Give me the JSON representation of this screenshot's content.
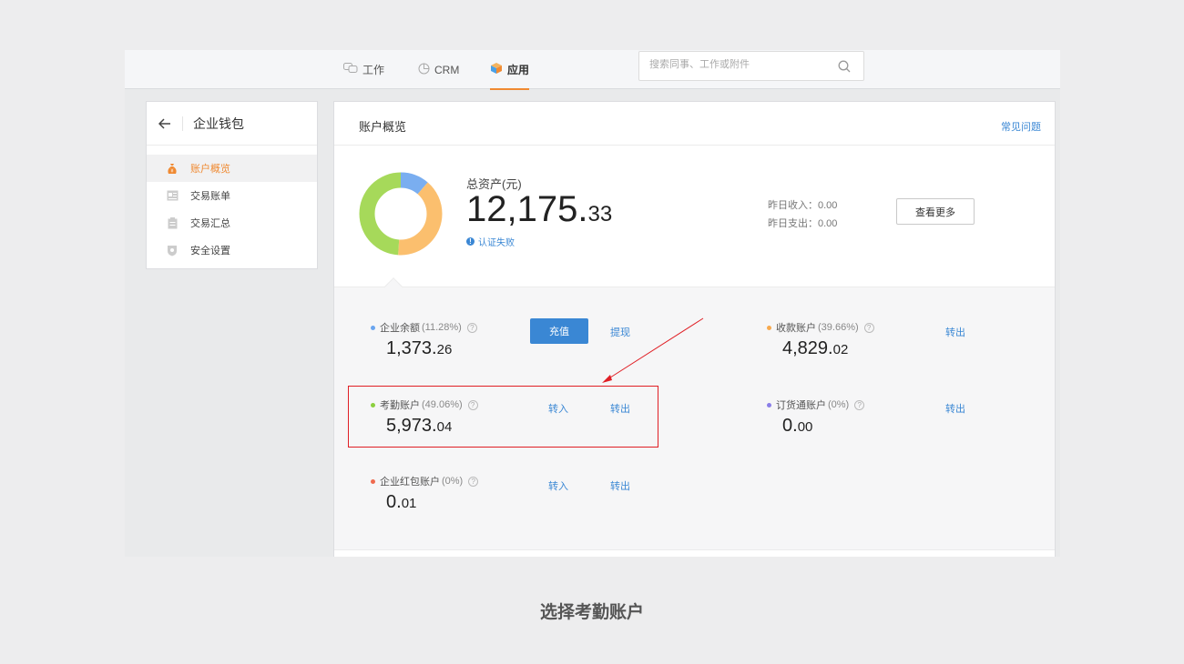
{
  "topnav": {
    "tabs": [
      {
        "label": "工作",
        "icon": "chat-bubbles-icon",
        "active": false
      },
      {
        "label": "CRM",
        "icon": "pie-icon",
        "active": false
      },
      {
        "label": "应用",
        "icon": "cube-icon",
        "active": true
      }
    ],
    "search_placeholder": "搜索同事、工作或附件"
  },
  "sidebar": {
    "title": "企业钱包",
    "items": [
      {
        "label": "账户概览",
        "icon": "money-bag-icon",
        "active": true
      },
      {
        "label": "交易账单",
        "icon": "bill-icon",
        "active": false
      },
      {
        "label": "交易汇总",
        "icon": "summary-icon",
        "active": false
      },
      {
        "label": "安全设置",
        "icon": "shield-icon",
        "active": false
      }
    ]
  },
  "main": {
    "title": "账户概览",
    "faq": "常见问题",
    "total_label": "总资产(元)",
    "total_int": "12,175.",
    "total_dec": "33",
    "auth_status": "认证失败",
    "yesterday_income": "昨日收入：0.00",
    "yesterday_expense": "昨日支出：0.00",
    "more_button": "查看更多",
    "donut": [
      {
        "name": "企业余额",
        "percent": 11.28,
        "color": "#7aaef0"
      },
      {
        "name": "收款账户",
        "percent": 39.66,
        "color": "#fbbf6e"
      },
      {
        "name": "考勤账户",
        "percent": 49.06,
        "color": "#a6d95a"
      }
    ]
  },
  "accounts": {
    "balance": {
      "name": "企业余额",
      "pct": "(11.28%)",
      "int": "1,373.",
      "dec": "26",
      "color": "#6aa5ef",
      "charge": "充值",
      "withdraw": "提现"
    },
    "receive": {
      "name": "收款账户",
      "pct": "(39.66%)",
      "int": "4,829.",
      "dec": "02",
      "color": "#f7a94e",
      "out": "转出"
    },
    "attendance": {
      "name": "考勤账户",
      "pct": "(49.06%)",
      "int": "5,973.",
      "dec": "04",
      "color": "#8ccf3e",
      "in": "转入",
      "out": "转出"
    },
    "order": {
      "name": "订货通账户",
      "pct": "(0%)",
      "int": "0.",
      "dec": "00",
      "color": "#8a7ee8",
      "out": "转出"
    },
    "redpacket": {
      "name": "企业红包账户",
      "pct": "(0%)",
      "int": "0.",
      "dec": "01",
      "color": "#ef6a4e",
      "in": "转入",
      "out": "转出"
    }
  },
  "caption": "选择考勤账户"
}
